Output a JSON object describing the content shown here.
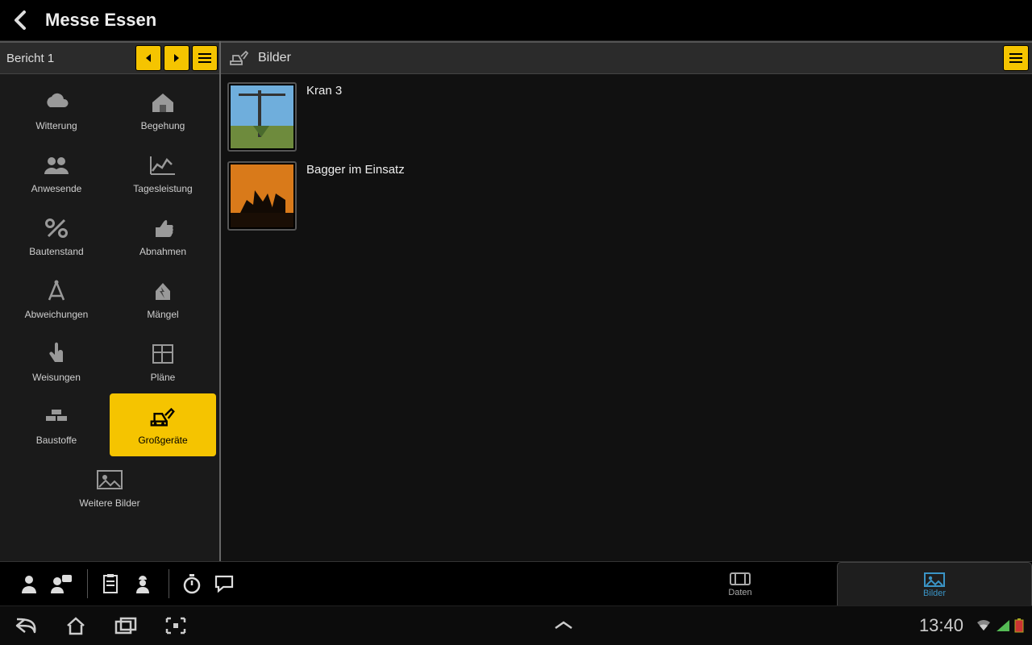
{
  "header": {
    "title": "Messe Essen"
  },
  "sidebar": {
    "report_label": "Bericht 1",
    "items": [
      {
        "label": "Witterung"
      },
      {
        "label": "Begehung"
      },
      {
        "label": "Anwesende"
      },
      {
        "label": "Tagesleistung"
      },
      {
        "label": "Bautenstand"
      },
      {
        "label": "Abnahmen"
      },
      {
        "label": "Abweichungen"
      },
      {
        "label": "Mängel"
      },
      {
        "label": "Weisungen"
      },
      {
        "label": "Pläne"
      },
      {
        "label": "Baustoffe"
      },
      {
        "label": "Großgeräte"
      },
      {
        "label": "Weitere Bilder"
      }
    ]
  },
  "content": {
    "title": "Bilder",
    "rows": [
      {
        "caption": "Kran 3"
      },
      {
        "caption": "Bagger im Einsatz"
      }
    ]
  },
  "tabs": {
    "center_label": "Daten",
    "right_label": "Bilder"
  },
  "system": {
    "time": "13:40"
  }
}
